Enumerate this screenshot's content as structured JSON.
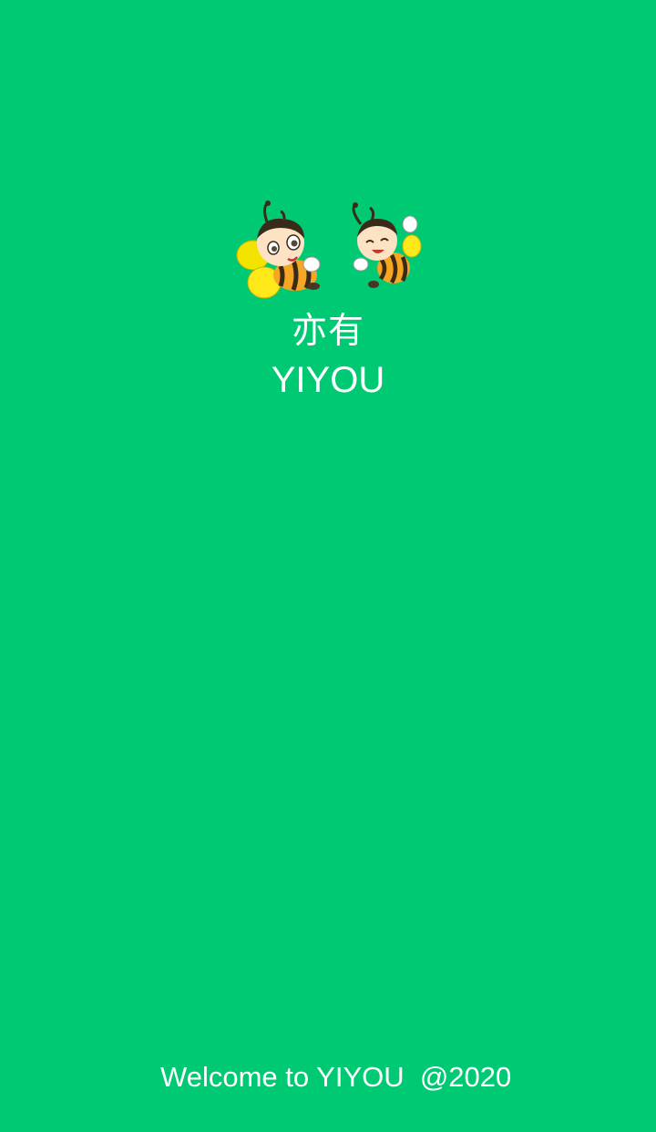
{
  "app": {
    "name_cn": "亦有",
    "name_en": "YIYOU",
    "logo_icon": "bee-mascot-icon"
  },
  "footer": {
    "welcome_text": "Welcome to YIYOU  @2020"
  },
  "colors": {
    "background": "#00c973",
    "text": "#ffffff",
    "bee_body": "#f5a623",
    "bee_stripe": "#3a2a1a",
    "bee_wing": "#ffe81a",
    "bee_face": "#fde3c4"
  }
}
